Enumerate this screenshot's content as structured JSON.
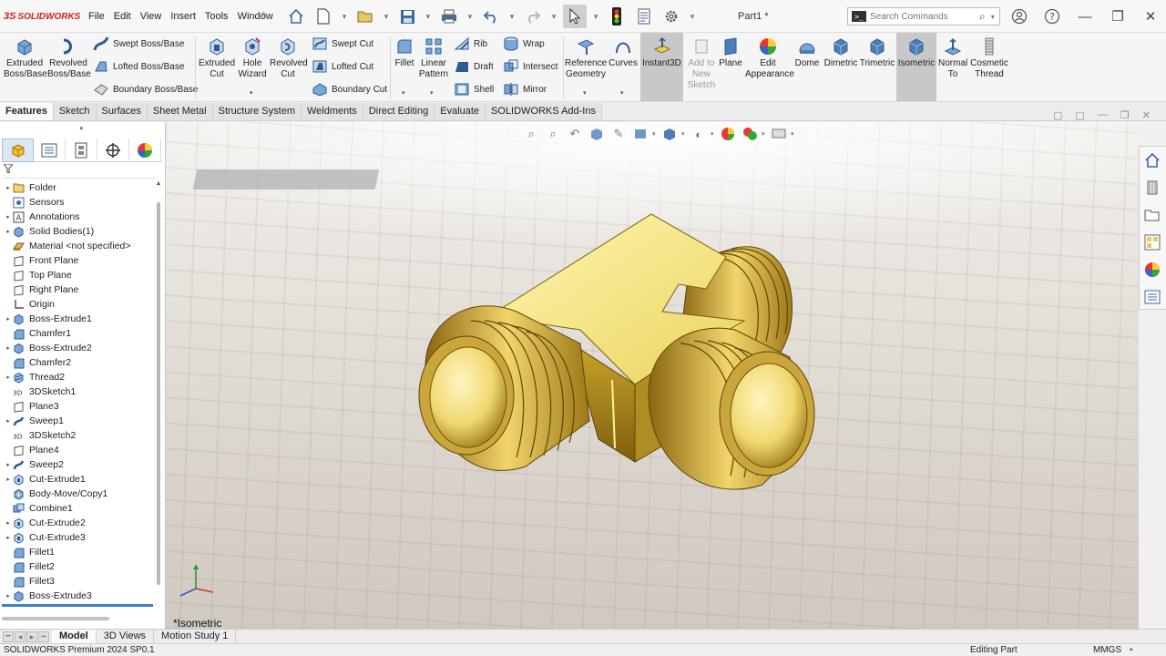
{
  "app": {
    "logo_ds": "3S",
    "logo_text": "SOLIDWORKS",
    "doc_title": "Part1 *"
  },
  "menu": [
    "File",
    "Edit",
    "View",
    "Insert",
    "Tools",
    "Window"
  ],
  "search": {
    "placeholder": "Search Commands"
  },
  "ribbon": {
    "extruded_boss": "Extruded\nBoss/Base",
    "revolved_boss": "Revolved\nBoss/Base",
    "swept_boss": "Swept Boss/Base",
    "lofted_boss": "Lofted Boss/Base",
    "boundary_boss": "Boundary Boss/Base",
    "extruded_cut": "Extruded\nCut",
    "hole_wizard": "Hole\nWizard",
    "revolved_cut": "Revolved\nCut",
    "swept_cut": "Swept Cut",
    "lofted_cut": "Lofted Cut",
    "boundary_cut": "Boundary Cut",
    "fillet": "Fillet",
    "linear_pattern": "Linear\nPattern",
    "rib": "Rib",
    "wrap": "Wrap",
    "draft": "Draft",
    "intersect": "Intersect",
    "shell": "Shell",
    "mirror": "Mirror",
    "reference_geometry": "Reference\nGeometry",
    "curves": "Curves",
    "instant3d": "Instant3D",
    "add_to_new_sketch": "Add to\nNew\nSketch",
    "plane": "Plane",
    "edit_appearance": "Edit\nAppearance",
    "dome": "Dome",
    "dimetric": "Dimetric",
    "trimetric": "Trimetric",
    "isometric": "Isometric",
    "normal_to": "Normal\nTo",
    "cosmetic_thread": "Cosmetic\nThread"
  },
  "command_tabs": [
    "Features",
    "Sketch",
    "Surfaces",
    "Sheet Metal",
    "Structure System",
    "Weldments",
    "Direct Editing",
    "Evaluate",
    "SOLIDWORKS Add-Ins"
  ],
  "feature_tree": [
    {
      "label": "Folder",
      "expandable": true,
      "icon": "folder-icon"
    },
    {
      "label": "Sensors",
      "expandable": false,
      "icon": "sensor-icon"
    },
    {
      "label": "Annotations",
      "expandable": true,
      "icon": "annotation-icon"
    },
    {
      "label": "Solid Bodies(1)",
      "expandable": true,
      "icon": "solid-bodies-icon"
    },
    {
      "label": "Material <not specified>",
      "expandable": false,
      "icon": "material-icon"
    },
    {
      "label": "Front Plane",
      "expandable": false,
      "icon": "plane-icon"
    },
    {
      "label": "Top Plane",
      "expandable": false,
      "icon": "plane-icon"
    },
    {
      "label": "Right Plane",
      "expandable": false,
      "icon": "plane-icon"
    },
    {
      "label": "Origin",
      "expandable": false,
      "icon": "origin-icon"
    },
    {
      "label": "Boss-Extrude1",
      "expandable": true,
      "icon": "extrude-icon"
    },
    {
      "label": "Chamfer1",
      "expandable": false,
      "icon": "chamfer-icon"
    },
    {
      "label": "Boss-Extrude2",
      "expandable": true,
      "icon": "extrude-icon"
    },
    {
      "label": "Chamfer2",
      "expandable": false,
      "icon": "chamfer-icon"
    },
    {
      "label": "Thread2",
      "expandable": true,
      "icon": "thread-icon"
    },
    {
      "label": "3DSketch1",
      "expandable": false,
      "icon": "sketch3d-icon"
    },
    {
      "label": "Plane3",
      "expandable": false,
      "icon": "plane-icon"
    },
    {
      "label": "Sweep1",
      "expandable": true,
      "icon": "sweep-icon"
    },
    {
      "label": "3DSketch2",
      "expandable": false,
      "icon": "sketch3d-icon"
    },
    {
      "label": "Plane4",
      "expandable": false,
      "icon": "plane-icon"
    },
    {
      "label": "Sweep2",
      "expandable": true,
      "icon": "sweep-icon"
    },
    {
      "label": "Cut-Extrude1",
      "expandable": true,
      "icon": "cut-extrude-icon"
    },
    {
      "label": "Body-Move/Copy1",
      "expandable": false,
      "icon": "move-body-icon"
    },
    {
      "label": "Combine1",
      "expandable": false,
      "icon": "combine-icon"
    },
    {
      "label": "Cut-Extrude2",
      "expandable": true,
      "icon": "cut-extrude-icon"
    },
    {
      "label": "Cut-Extrude3",
      "expandable": true,
      "icon": "cut-extrude-icon"
    },
    {
      "label": "Fillet1",
      "expandable": false,
      "icon": "fillet-icon"
    },
    {
      "label": "Fillet2",
      "expandable": false,
      "icon": "fillet-icon"
    },
    {
      "label": "Fillet3",
      "expandable": false,
      "icon": "fillet-icon"
    },
    {
      "label": "Boss-Extrude3",
      "expandable": true,
      "icon": "extrude-icon"
    }
  ],
  "viewport": {
    "view_label": "*Isometric"
  },
  "bottom_tabs": [
    "Model",
    "3D Views",
    "Motion Study 1"
  ],
  "status": {
    "product": "SOLIDWORKS Premium 2024 SP0.1",
    "mode": "Editing Part",
    "units": "MMGS"
  },
  "colors": {
    "brand_red": "#d0201f",
    "icon_blue": "#4a7fb5",
    "model_gold": "#e8cf5a",
    "rollback_blue": "#3b7fc9"
  }
}
